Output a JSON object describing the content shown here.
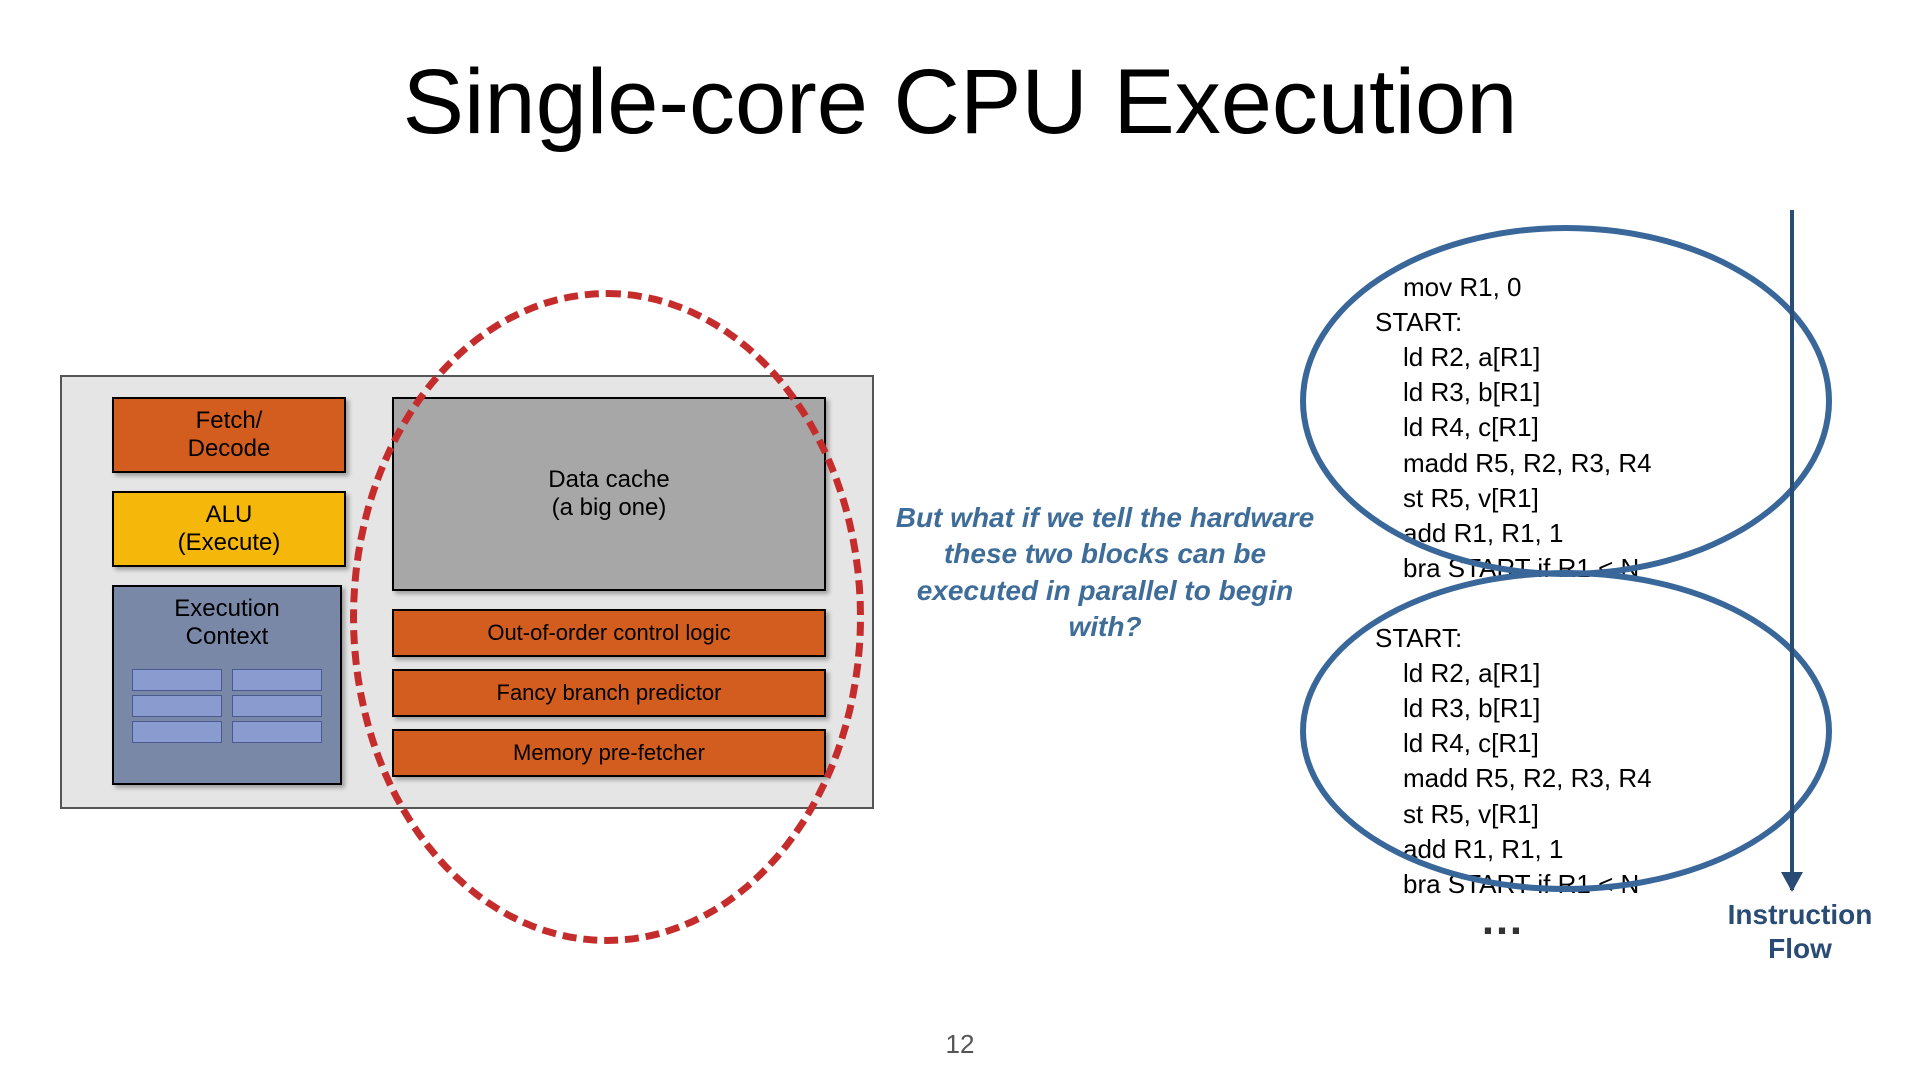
{
  "title": "Single-core CPU Execution",
  "page_number": "12",
  "cpu": {
    "fetch_decode": "Fetch/\nDecode",
    "alu": "ALU\n(Execute)",
    "exec_context": "Execution\nContext",
    "data_cache_l1": "Data cache",
    "data_cache_l2": "(a big one)",
    "ooo": "Out-of-order control logic",
    "branch_predictor": "Fancy branch predictor",
    "prefetcher": "Memory pre-fetcher"
  },
  "hint": "But what if we tell the hardware these two blocks can be executed in parallel to begin with?",
  "code": {
    "line1": "mov R1, 0",
    "label1": "START:",
    "b1l1": "ld R2, a[R1]",
    "b1l2": "ld R3, b[R1]",
    "b1l3": "ld R4, c[R1]",
    "b1l4": "madd R5, R2, R3, R4",
    "b1l5": "st R5, v[R1]",
    "b1l6": "add R1, R1, 1",
    "b1l7": "bra START if R1 < N",
    "label2": "START:",
    "b2l1": "ld R2, a[R1]",
    "b2l2": "ld R3, b[R1]",
    "b2l3": "ld R4, c[R1]",
    "b2l4": "madd R5, R2, R3, R4",
    "b2l5": "st R5, v[R1]",
    "b2l6": "add R1, R1, 1",
    "b2l7": "bra START if R1 < N"
  },
  "ellipsis": "…",
  "arrow_label_l1": "Instruction",
  "arrow_label_l2": "Flow"
}
